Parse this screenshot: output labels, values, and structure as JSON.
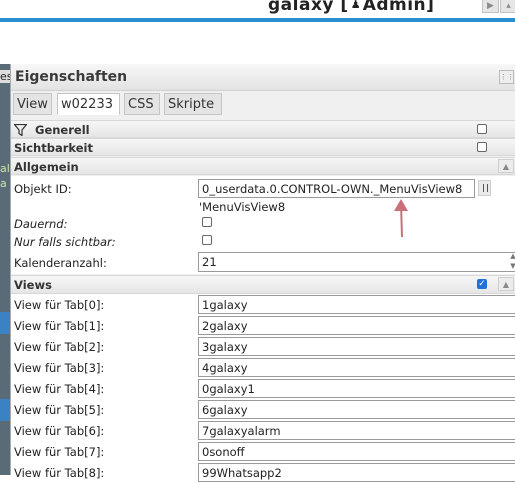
{
  "header": {
    "title_prefix": "galaxy [",
    "user_icon": "user-icon",
    "title_user": "Admin",
    "title_suffix": "]"
  },
  "left_strip": {
    "chars": [
      "es",
      "al",
      "a"
    ]
  },
  "panel": {
    "title": "Eigenschaften",
    "tabs": [
      {
        "label": "View"
      },
      {
        "label": "w02233"
      },
      {
        "label": "CSS"
      },
      {
        "label": "Skripte"
      }
    ]
  },
  "groups": {
    "generell": "Generell",
    "sichtbarkeit": "Sichtbarkeit",
    "allgemein": "Allgemein",
    "views": "Views"
  },
  "allgemein": {
    "objekt_id_label": "Objekt ID:",
    "objekt_id_value": "0_userdata.0.CONTROL-OWN._MenuVisView8",
    "objekt_id_hint": "'MenuVisView8",
    "dauernd_label": "Dauernd:",
    "nur_falls_sichtbar_label": "Nur falls sichtbar:",
    "kalenderanzahl_label": "Kalenderanzahl:",
    "kalenderanzahl_value": "21"
  },
  "views": {
    "checked": true,
    "items": [
      {
        "label": "View für Tab[0]:",
        "value": "1galaxy"
      },
      {
        "label": "View für Tab[1]:",
        "value": "2galaxy"
      },
      {
        "label": "View für Tab[2]:",
        "value": "3galaxy"
      },
      {
        "label": "View für Tab[3]:",
        "value": "4galaxy"
      },
      {
        "label": "View für Tab[4]:",
        "value": "0galaxy1"
      },
      {
        "label": "View für Tab[5]:",
        "value": "6galaxy"
      },
      {
        "label": "View für Tab[6]:",
        "value": "7galaxyalarm"
      },
      {
        "label": "View für Tab[7]:",
        "value": "0sonoff"
      },
      {
        "label": "View für Tab[8]:",
        "value": "99Whatsapp2"
      }
    ]
  },
  "colors": {
    "accent": "#2a8ed0",
    "annotation_arrow": "#c9707a",
    "checkbox_checked": "#1e74d6"
  }
}
